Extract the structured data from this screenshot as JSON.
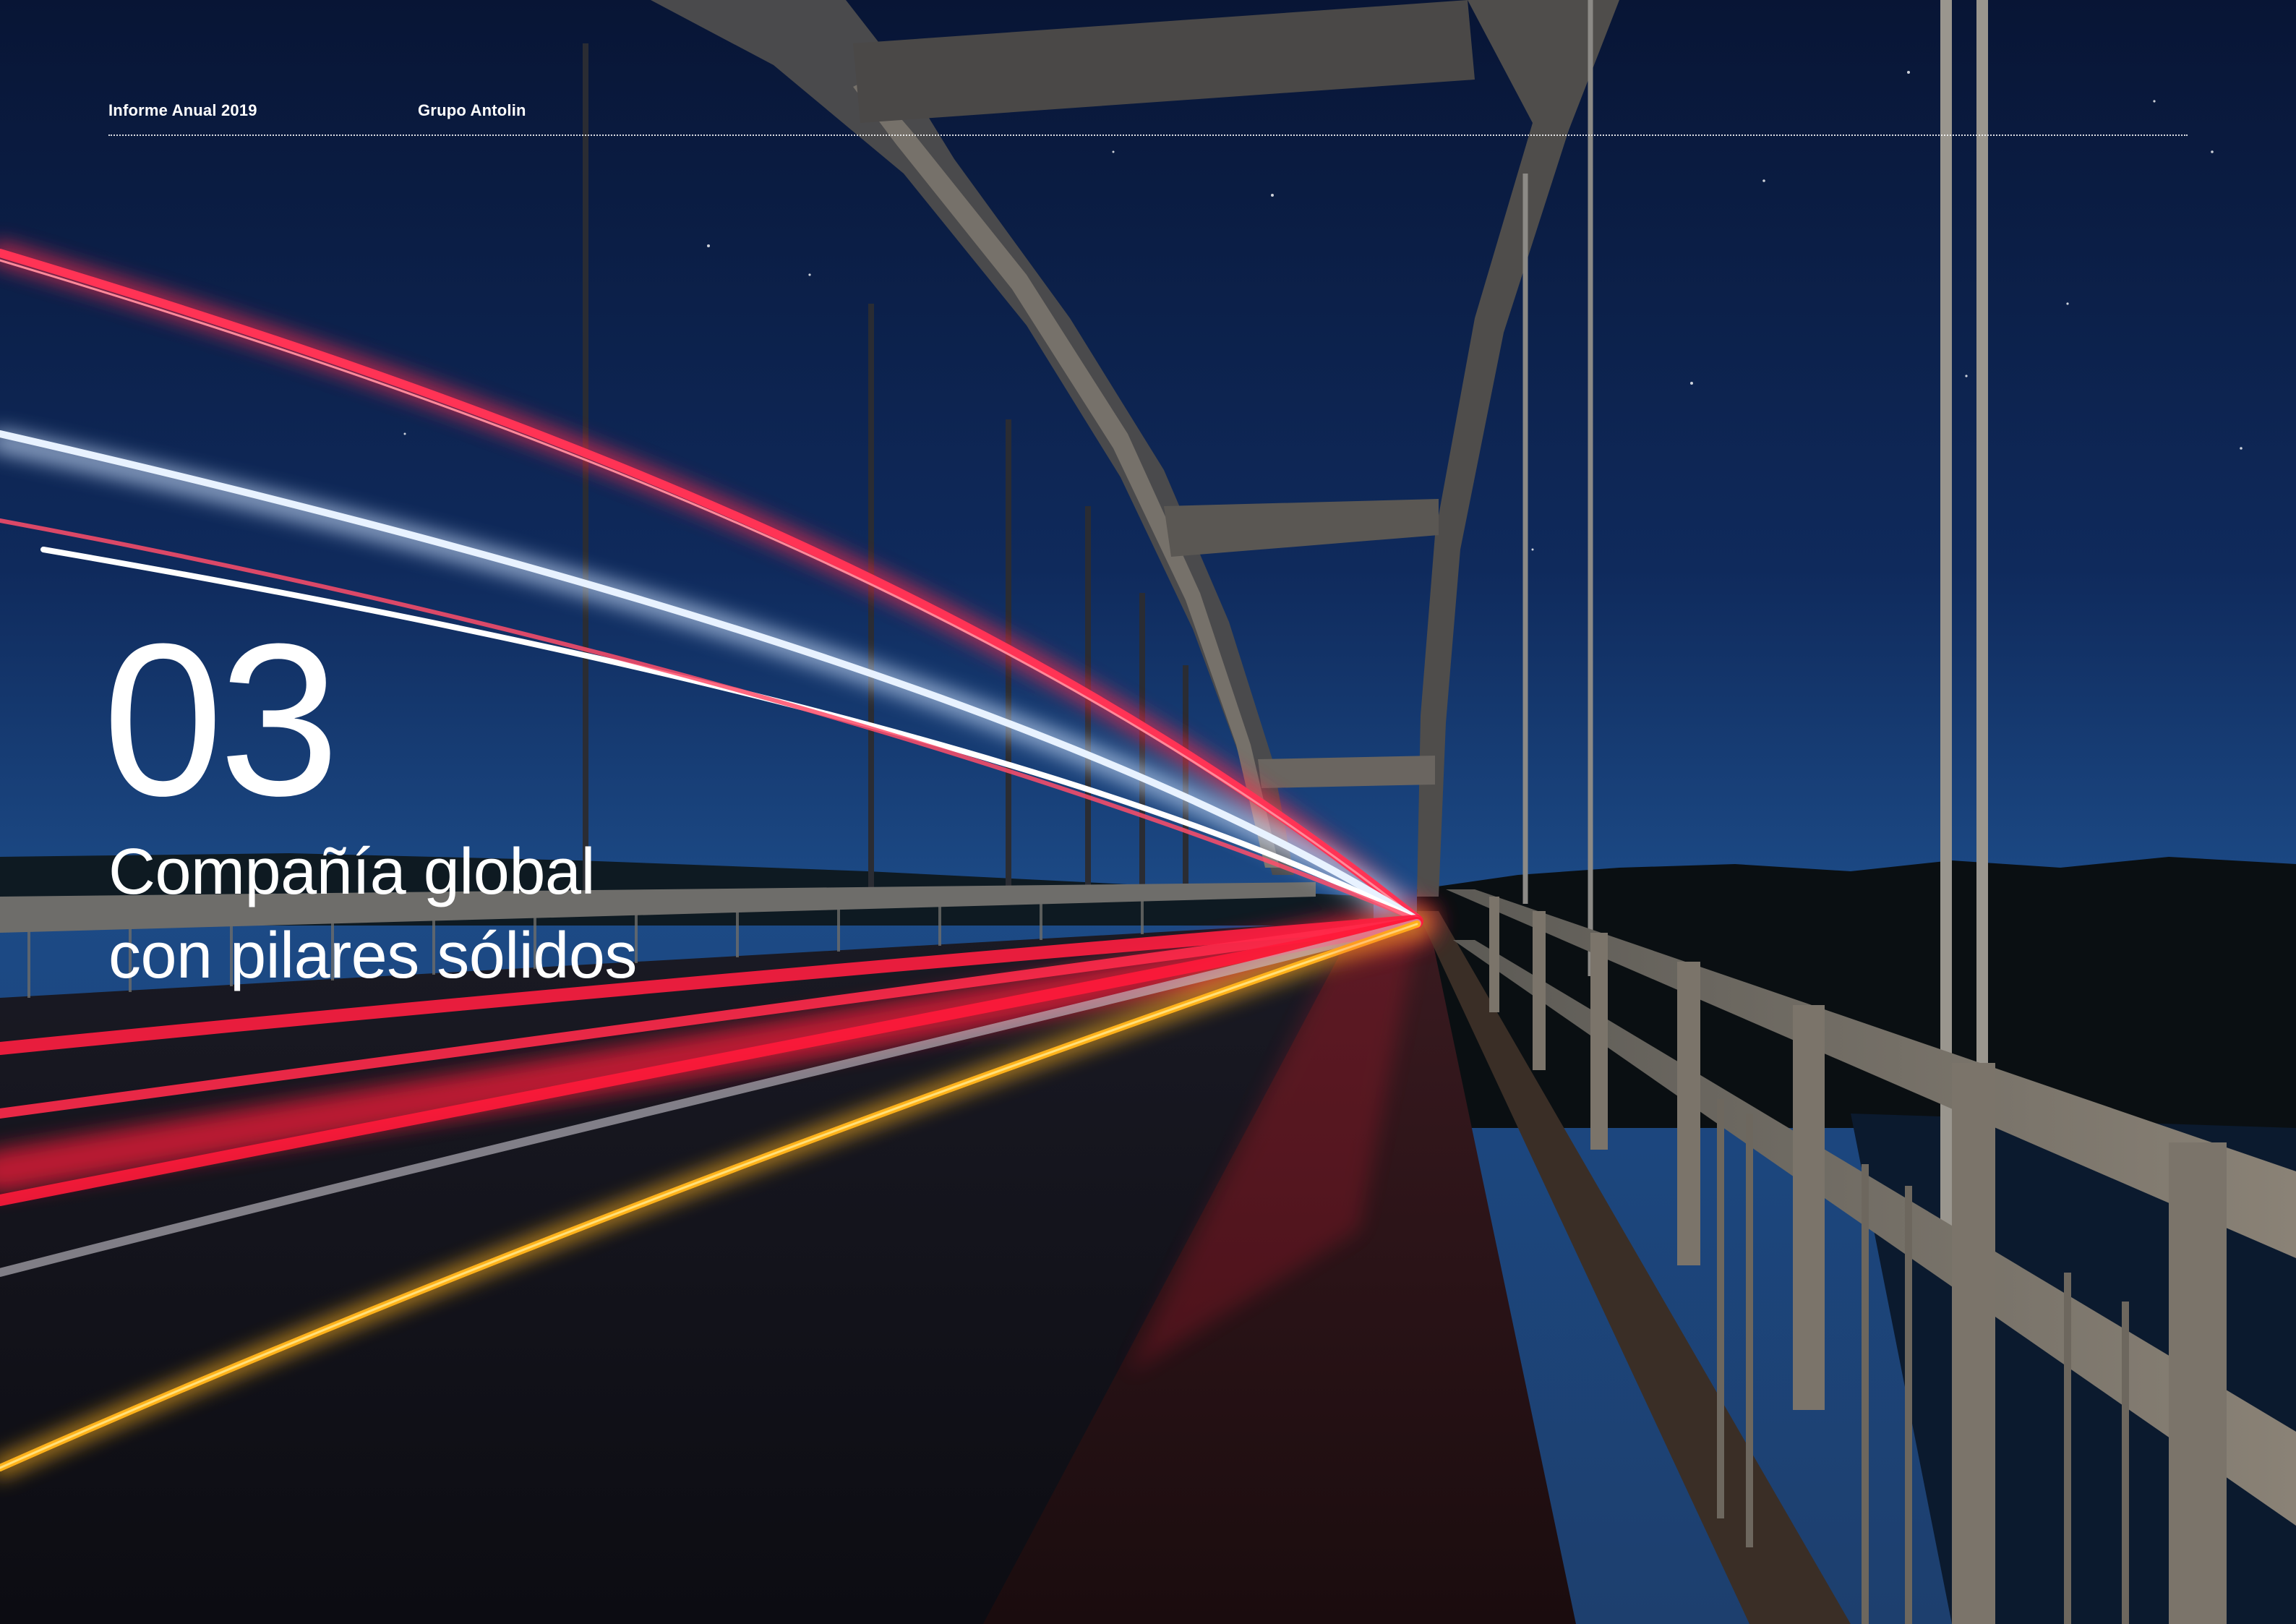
{
  "header": {
    "report_label": "Informe Anual 2019",
    "company_label": "Grupo Antolin"
  },
  "chapter": {
    "number": "03",
    "title_line1": "Compañía global",
    "title_line2": "con pilares sólidos"
  },
  "background": {
    "description_icon": "night-bridge-light-trails-photo",
    "colors": {
      "sky_top": "#0a1a3c",
      "sky_horizon": "#1f4d8c",
      "trail_red": "#ff2a4a",
      "trail_white": "#e8f2ff",
      "trail_amber": "#ffb21a"
    }
  }
}
